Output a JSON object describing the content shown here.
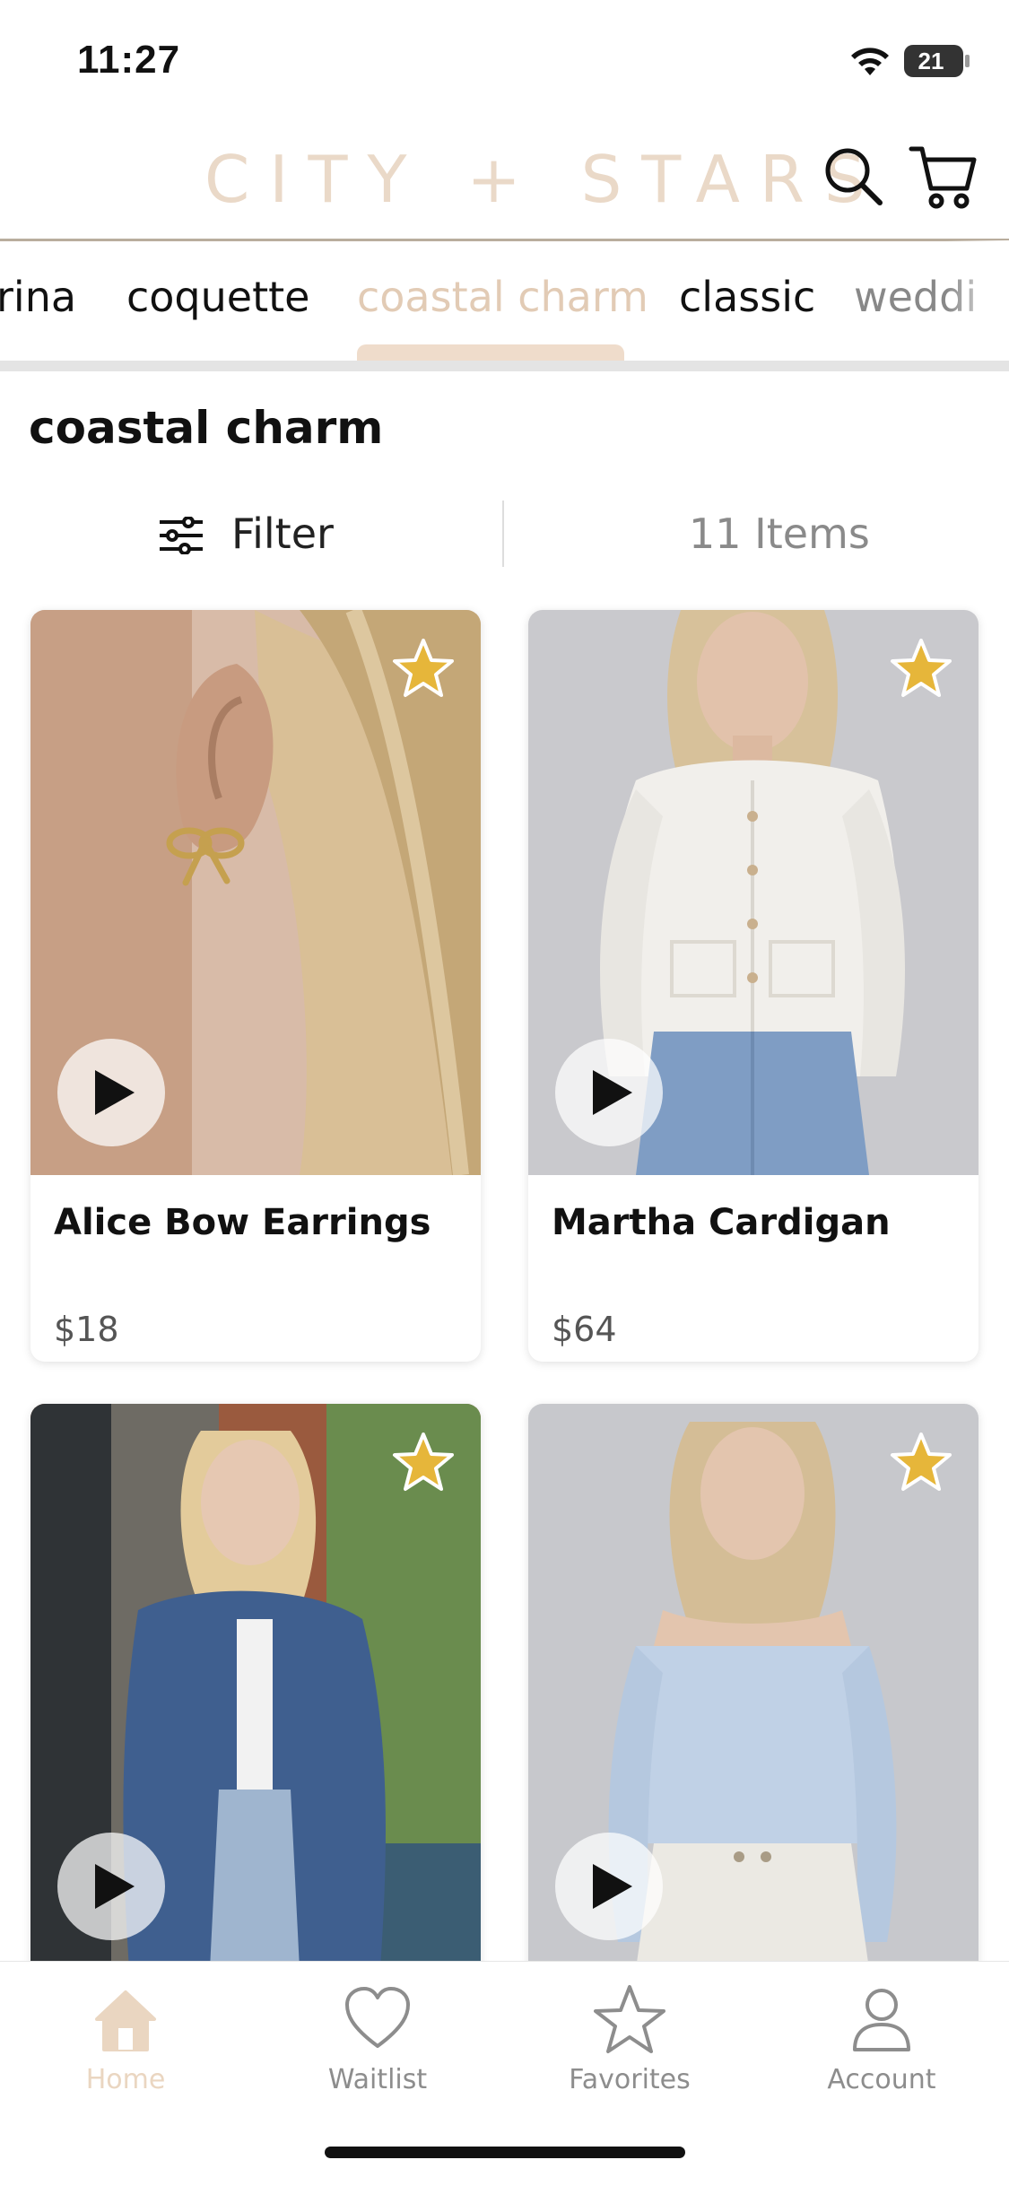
{
  "status_bar": {
    "time": "11:27",
    "battery": "21"
  },
  "header": {
    "logo": "CITY + STARS"
  },
  "category_tabs": [
    {
      "label": "rina"
    },
    {
      "label": "coquette"
    },
    {
      "label": "coastal charm",
      "active": true
    },
    {
      "label": "classic"
    },
    {
      "label": "weddi"
    }
  ],
  "section": {
    "title": "coastal charm"
  },
  "filter": {
    "label": "Filter",
    "items_count": "11 Items"
  },
  "products": [
    {
      "name": "Alice Bow Earrings",
      "price": "$18"
    },
    {
      "name": "Martha Cardigan",
      "price": "$64"
    },
    {
      "name": "",
      "price": ""
    },
    {
      "name": "",
      "price": ""
    }
  ],
  "bottom_nav": [
    {
      "label": "Home",
      "icon": "home-icon",
      "active": true
    },
    {
      "label": "Waitlist",
      "icon": "heart-icon"
    },
    {
      "label": "Favorites",
      "icon": "star-icon"
    },
    {
      "label": "Account",
      "icon": "person-icon"
    }
  ],
  "colors": {
    "accent": "#ead6c1",
    "star": "#e6b63a",
    "tab_indicator": "#efdccb"
  }
}
